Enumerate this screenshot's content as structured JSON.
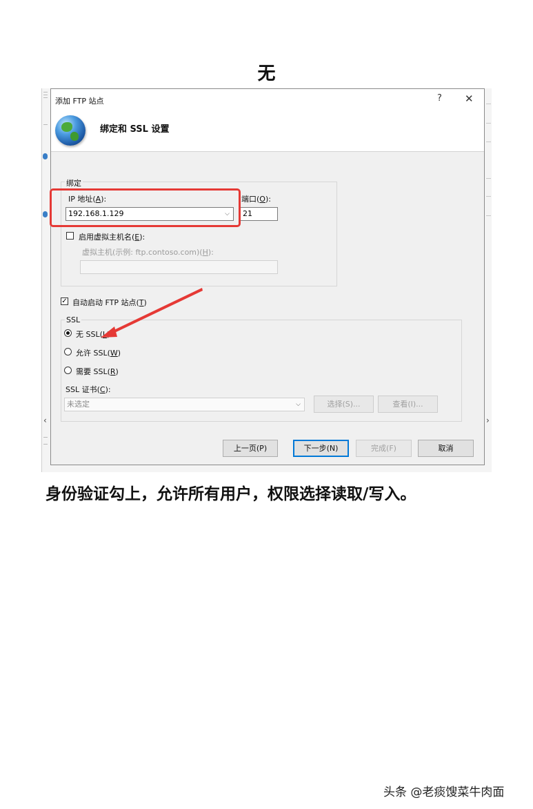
{
  "heading": "无",
  "dialog": {
    "title": "添加 FTP 站点",
    "help": "?",
    "close": "✕",
    "subtitle": "绑定和 SSL 设置"
  },
  "binding": {
    "group_label": "绑定",
    "ip_label": "IP 地址(",
    "ip_key": "A",
    "ip_label_end": "):",
    "ip_value": "192.168.1.129",
    "port_label": "端口(",
    "port_key": "O",
    "port_label_end": "):",
    "port_value": "21",
    "vhost_label": "启用虚拟主机名(",
    "vhost_key": "E",
    "vhost_label_end": "):",
    "vhost_hint": "虚拟主机(示例: ftp.contoso.com)(",
    "vhost_hint_key": "H",
    "vhost_hint_end": "):",
    "vhost_value": ""
  },
  "autostart": {
    "label": "自动启动 FTP 站点(",
    "key": "T",
    "label_end": ")",
    "checked": true
  },
  "ssl": {
    "group_label": "SSL",
    "options": [
      {
        "label": "无 SSL(",
        "key": "L",
        "end": ")",
        "checked": true
      },
      {
        "label": "允许 SSL(",
        "key": "W",
        "end": ")",
        "checked": false
      },
      {
        "label": "需要 SSL(",
        "key": "R",
        "end": ")",
        "checked": false
      }
    ],
    "cert_label": "SSL 证书(",
    "cert_key": "C",
    "cert_label_end": "):",
    "cert_value": "未选定",
    "select_btn": "选择(S)...",
    "view_btn": "查看(I)..."
  },
  "footer": {
    "prev": "上一页(P)",
    "next": "下一步(N)",
    "finish": "完成(F)",
    "cancel": "取消"
  },
  "annotation": {
    "box_color": "#e53935",
    "arrow_color": "#e53935"
  },
  "caption": "身份验证勾上，允许所有用户，权限选择读取/写入。",
  "watermark": "头条 @老痰馊菜牛肉面"
}
